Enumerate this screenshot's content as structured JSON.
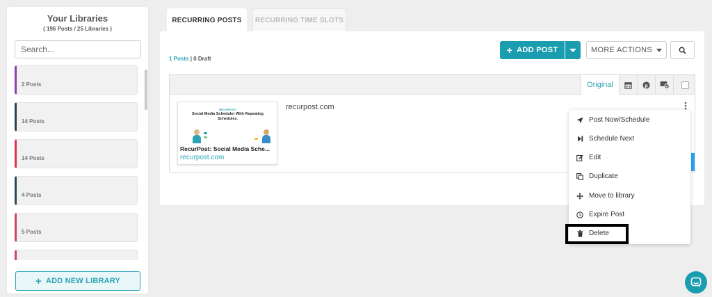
{
  "sidebar": {
    "title": "Your Libraries",
    "subtitle": "( 196 Posts / 25 Libraries )",
    "search_placeholder": "Search...",
    "libraries": [
      {
        "count": "2 Posts",
        "color": "#8e3fb0"
      },
      {
        "count": "14 Posts",
        "color": "#2a3f52"
      },
      {
        "count": "14 Posts",
        "color": "#d9344f"
      },
      {
        "count": "4 Posts",
        "color": "#2a4a5a"
      },
      {
        "count": "5 Posts",
        "color": "#c9485e"
      },
      {
        "count": "",
        "color": "#c9485e"
      }
    ],
    "add_library_label": "ADD NEW LIBRARY"
  },
  "tabs": [
    {
      "label": "RECURRING POSTS",
      "active": true
    },
    {
      "label": "RECURRING TIME SLOTS",
      "active": false
    }
  ],
  "toolbar": {
    "posts_count": "1 Posts",
    "separator": "|",
    "draft_count": "0 Draft",
    "add_post_label": "ADD POST",
    "more_actions_label": "MORE ACTIONS"
  },
  "table": {
    "original_label": "Original"
  },
  "post": {
    "preview_brand": "RECURPOST",
    "preview_headline": "Social Media Scheduler With Repeating Schedules.",
    "preview_title": "RecurPost: Social Media Sche...",
    "preview_url": "recurpost.com",
    "text": "recurpost.com"
  },
  "menu": {
    "items": [
      {
        "label": "Post Now/Schedule",
        "icon": "paper-plane-icon"
      },
      {
        "label": "Schedule Next",
        "icon": "skip-next-icon"
      },
      {
        "label": "Edit",
        "icon": "edit-icon"
      },
      {
        "label": "Duplicate",
        "icon": "duplicate-icon"
      },
      {
        "label": "Move to library",
        "icon": "move-icon"
      },
      {
        "label": "Expire Post",
        "icon": "clock-icon"
      },
      {
        "label": "Delete",
        "icon": "trash-icon"
      }
    ]
  },
  "colors": {
    "accent": "#1a9daf",
    "link": "#2aa3b5"
  }
}
